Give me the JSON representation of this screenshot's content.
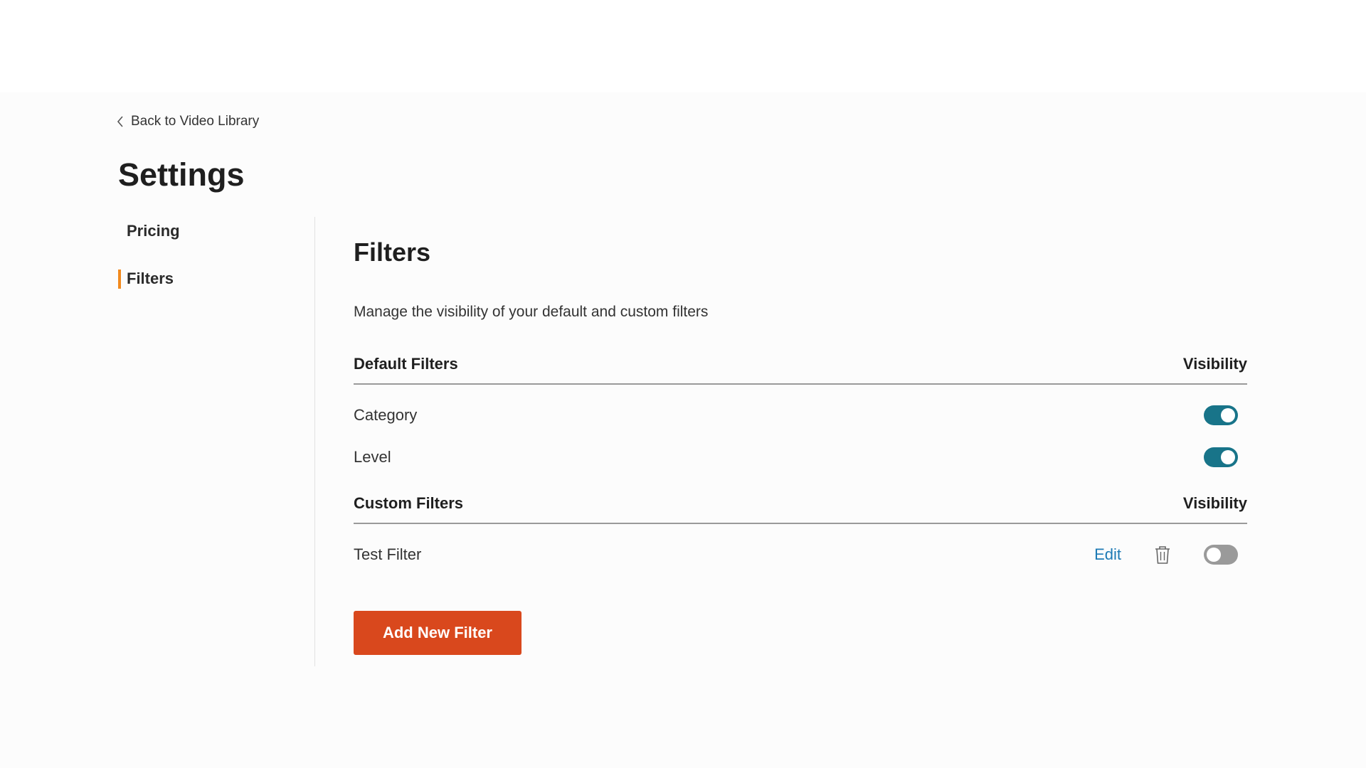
{
  "back_link": {
    "label": "Back to Video Library",
    "icon": "chevron-left-icon"
  },
  "page_title": "Settings",
  "sidebar": {
    "items": [
      {
        "label": "Pricing",
        "active": false
      },
      {
        "label": "Filters",
        "active": true
      }
    ],
    "active_accent": "#f28a1e"
  },
  "filters": {
    "title": "Filters",
    "description": "Manage the visibility of your default and custom filters",
    "default_section": {
      "header": "Default Filters",
      "visibility_header": "Visibility",
      "rows": [
        {
          "label": "Category",
          "visible": true
        },
        {
          "label": "Level",
          "visible": true
        }
      ]
    },
    "custom_section": {
      "header": "Custom Filters",
      "visibility_header": "Visibility",
      "rows": [
        {
          "label": "Test Filter",
          "edit_label": "Edit",
          "delete_icon": "trash-icon",
          "visible": false
        }
      ]
    },
    "add_button_label": "Add New Filter"
  },
  "colors": {
    "toggle_on": "#187489",
    "toggle_off": "#9a9a9a",
    "primary_button": "#d9481d",
    "link": "#1d7ab5"
  }
}
